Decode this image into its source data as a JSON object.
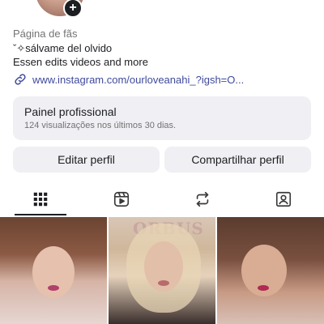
{
  "profile": {
    "category": "Página de fãs",
    "bio_line1": "ˇ✧sálvame del olvido",
    "bio_line2": "Essen edits videos and more",
    "link": "www.instagram.com/ourloveanahi_?igsh=O..."
  },
  "professional_panel": {
    "title": "Painel profissional",
    "subtitle": "124 visualizações nos últimos 30 dias."
  },
  "actions": {
    "edit": "Editar perfil",
    "share": "Compartilhar perfil"
  },
  "tabs": [
    {
      "icon": "grid-icon",
      "active": true
    },
    {
      "icon": "reels-icon",
      "active": false
    },
    {
      "icon": "reposts-icon",
      "active": false
    },
    {
      "icon": "tagged-icon",
      "active": false
    }
  ],
  "posts": {
    "post2_overlay": "ORBUS"
  },
  "colors": {
    "link": "#3f4a9c",
    "button_bg": "#efeff4",
    "text": "#1c1e21",
    "secondary_text": "#737373"
  }
}
